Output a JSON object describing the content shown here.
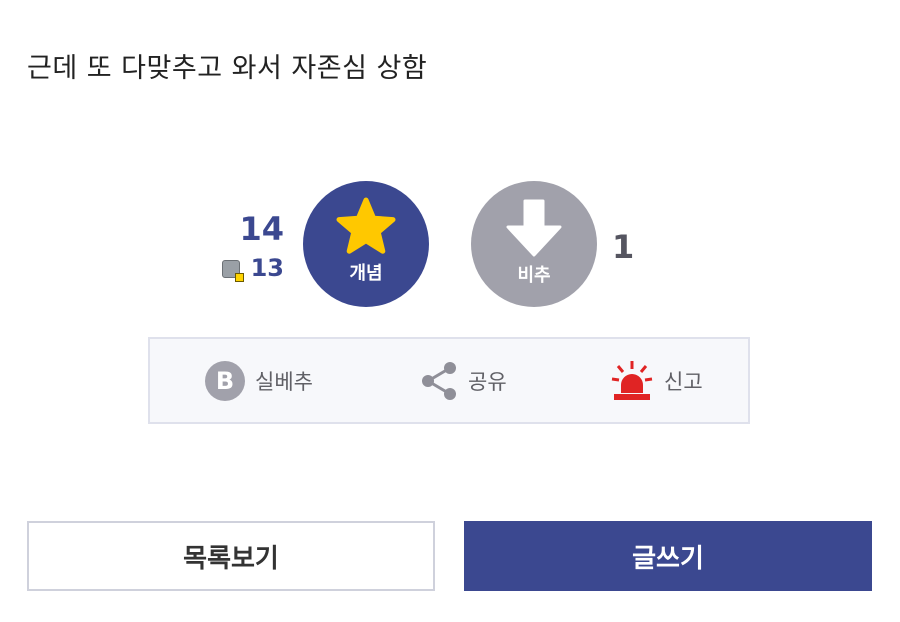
{
  "post": {
    "body_text": "근데 또 다맞추고 와서 자존심 상함"
  },
  "recommend": {
    "up_count": "14",
    "fixed_count": "13",
    "up_label": "개념",
    "down_label": "비추",
    "down_count": "1"
  },
  "actions": {
    "best_label": "실베추",
    "best_badge": "B",
    "share_label": "공유",
    "report_label": "신고"
  },
  "bottom": {
    "list_label": "목록보기",
    "write_label": "글쓰기"
  },
  "colors": {
    "accent": "#3b4890",
    "down_gray": "#a1a1ab",
    "star": "#ffc800",
    "alarm_red": "#e02424"
  }
}
